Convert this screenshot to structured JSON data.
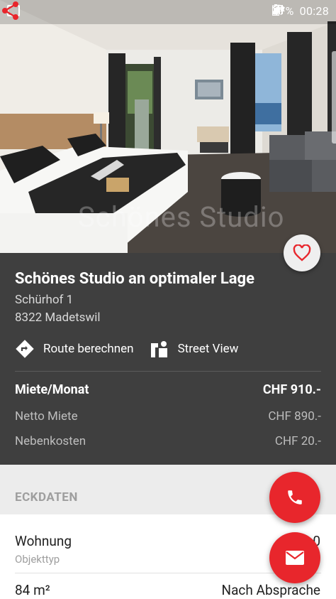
{
  "status_bar": {
    "battery": "47%",
    "time": "00:28"
  },
  "hero": {
    "watermark": "Schönes Studio"
  },
  "listing": {
    "title": "Schönes Studio an optimaler Lage",
    "street": "Schürhof 1",
    "city": "8322 Madetswil",
    "actions": {
      "route": "Route berechnen",
      "street_view": "Street View"
    },
    "costs": {
      "rent_label": "Miete/Monat",
      "rent_value": "CHF 910.-",
      "net_label": "Netto Miete",
      "net_value": "CHF 890.-",
      "side_label": "Nebenkosten",
      "side_value": "CHF 20.-"
    }
  },
  "section": {
    "title": "ECKDATEN"
  },
  "keydata": {
    "type_value": "Wohnung",
    "type_label": "Objekttyp",
    "rooms_value": "1.0",
    "area": "84 m²",
    "availability": "Nach Absprache"
  },
  "colors": {
    "accent": "#e8262c",
    "panel": "#3f3f3f"
  },
  "icons": [
    "gallery-icon",
    "share-icon",
    "heart-icon",
    "route-icon",
    "street-view-icon",
    "phone-icon",
    "mail-icon"
  ]
}
